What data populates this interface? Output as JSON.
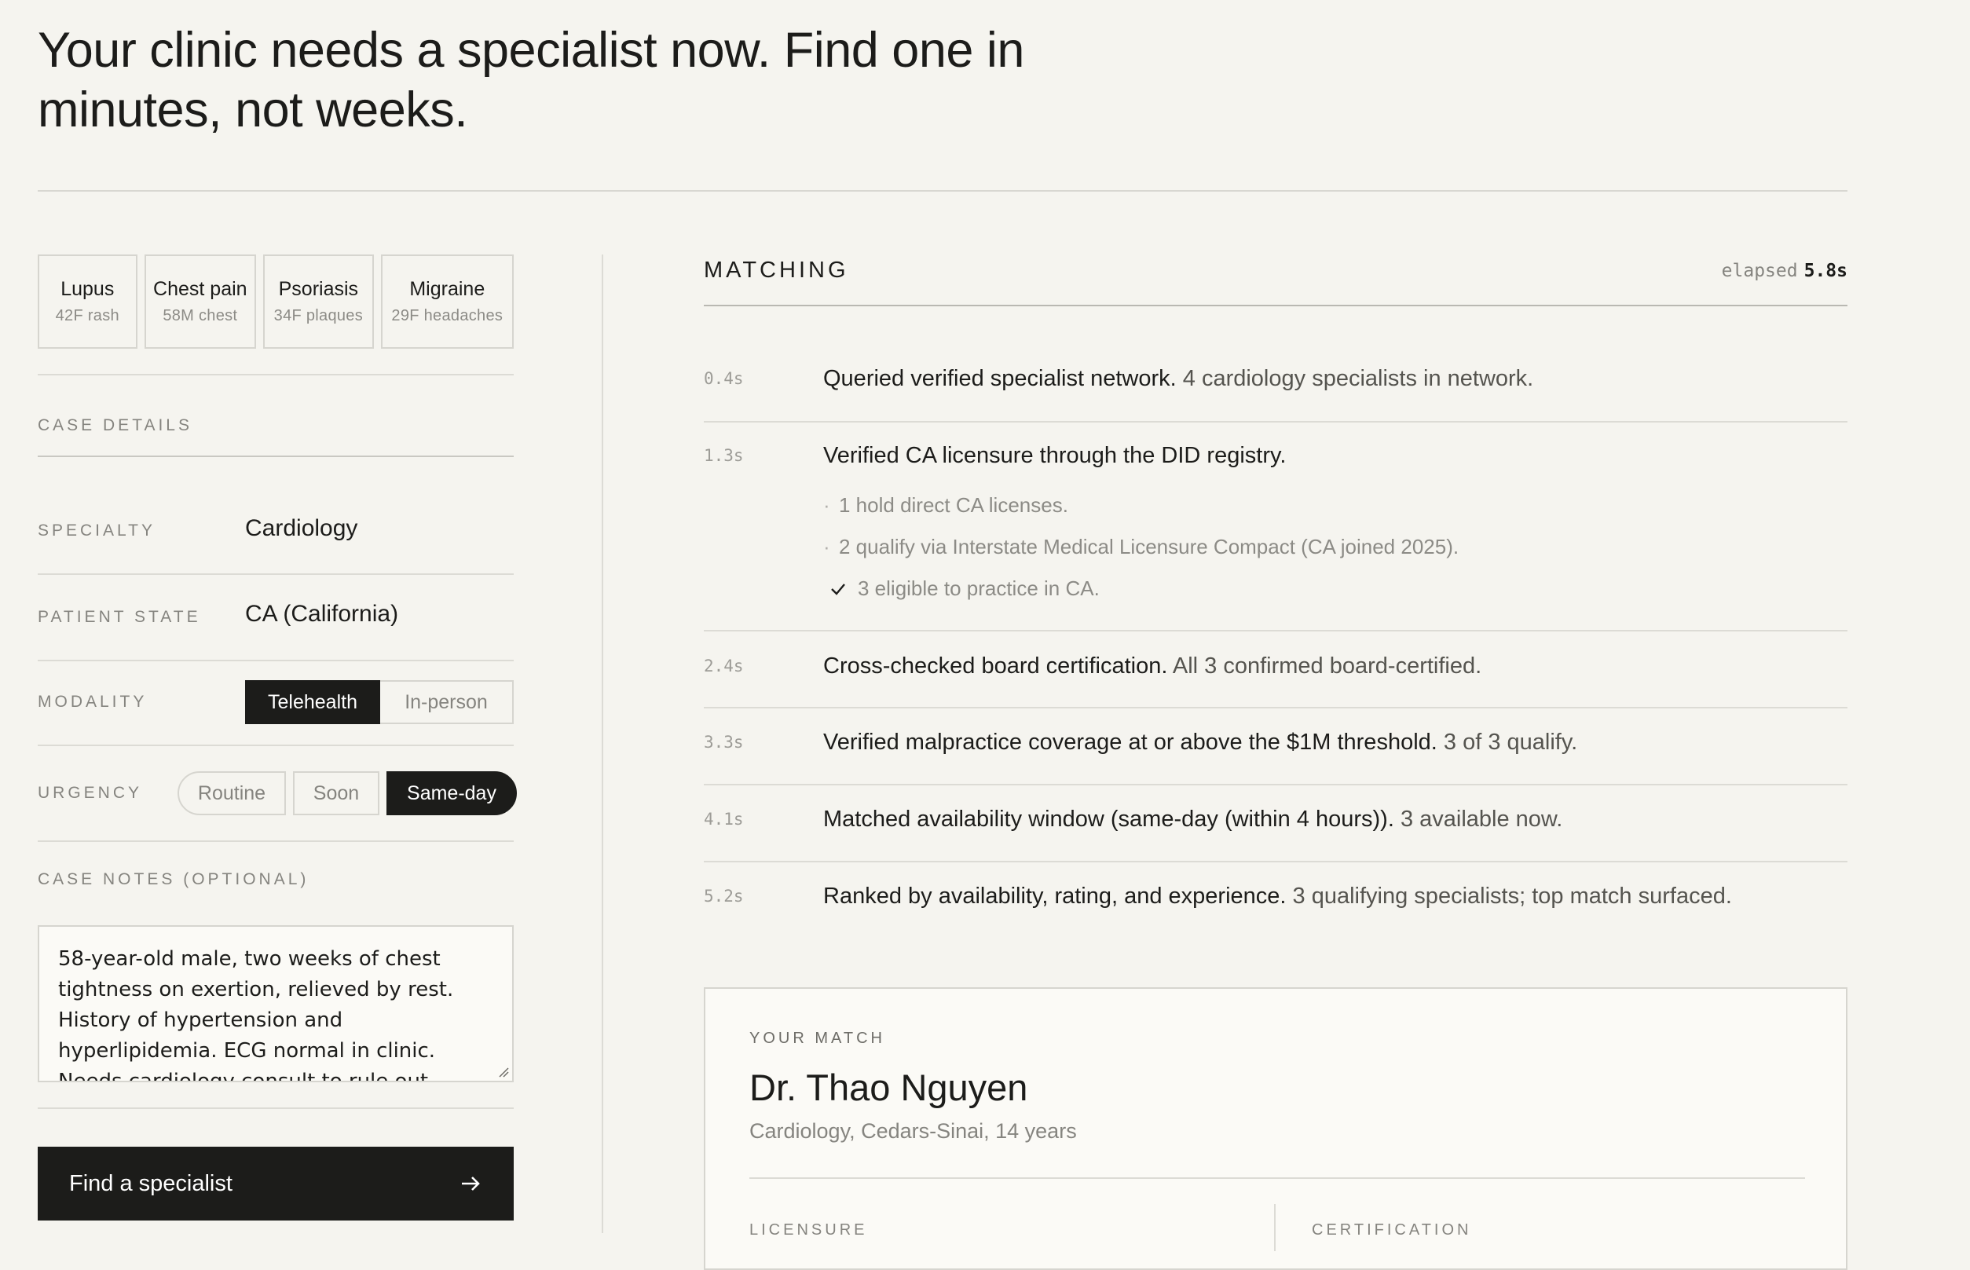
{
  "headline": "Your clinic needs a specialist now. Find one in minutes, not weeks.",
  "presets": [
    {
      "title": "Lupus",
      "sub": "42F rash"
    },
    {
      "title": "Chest pain",
      "sub": "58M chest"
    },
    {
      "title": "Psoriasis",
      "sub": "34F plaques"
    },
    {
      "title": "Migraine",
      "sub": "29F headaches"
    }
  ],
  "case": {
    "section_label": "CASE DETAILS",
    "specialty_label": "SPECIALTY",
    "specialty_value": "Cardiology",
    "state_label": "PATIENT STATE",
    "state_value": "CA (California)",
    "modality_label": "MODALITY",
    "modality_options": [
      "Telehealth",
      "In-person"
    ],
    "modality_selected": "Telehealth",
    "urgency_label": "URGENCY",
    "urgency_options": [
      "Routine",
      "Soon",
      "Same-day"
    ],
    "urgency_selected": "Same-day",
    "notes_label": "CASE NOTES (OPTIONAL)",
    "notes_value": "58-year-old male, two weeks of chest tightness on exertion, relieved by rest. History of hypertension and hyperlipidemia. ECG normal in clinic. Needs cardiology consult to rule out unstable angina.",
    "find_button": "Find a specialist"
  },
  "matching": {
    "title": "MATCHING",
    "elapsed_label": "elapsed",
    "elapsed_value": "5.8s",
    "steps": [
      {
        "time": "0.4s",
        "strong": "Queried verified specialist network.",
        "rest": " 4 cardiology specialists in network."
      },
      {
        "time": "1.3s",
        "strong": "Verified CA licensure through the DID registry.",
        "rest": "",
        "subs": [
          {
            "mark": "·",
            "text": "1 hold direct CA licenses."
          },
          {
            "mark": "·",
            "text": "2 qualify via Interstate Medical Licensure Compact (CA joined 2025)."
          },
          {
            "mark": "check",
            "text": "3 eligible to practice in CA."
          }
        ]
      },
      {
        "time": "2.4s",
        "strong": "Cross-checked board certification.",
        "rest": " All 3 confirmed board-certified."
      },
      {
        "time": "3.3s",
        "strong": "Verified malpractice coverage at or above the $1M threshold.",
        "rest": " 3 of 3 qualify."
      },
      {
        "time": "4.1s",
        "strong": "Matched availability window (same-day (within 4 hours)).",
        "rest": " 3 available now."
      },
      {
        "time": "5.2s",
        "strong": "Ranked by availability, rating, and experience.",
        "rest": " 3 qualifying specialists; top match surfaced."
      }
    ]
  },
  "match": {
    "label": "YOUR MATCH",
    "name": "Dr. Thao Nguyen",
    "subtitle": "Cardiology, Cedars-Sinai, 14 years",
    "col1_label": "LICENSURE",
    "col2_label": "CERTIFICATION"
  },
  "icons": {
    "find_button": "arrow-right-icon",
    "sub_check": "check-icon"
  }
}
